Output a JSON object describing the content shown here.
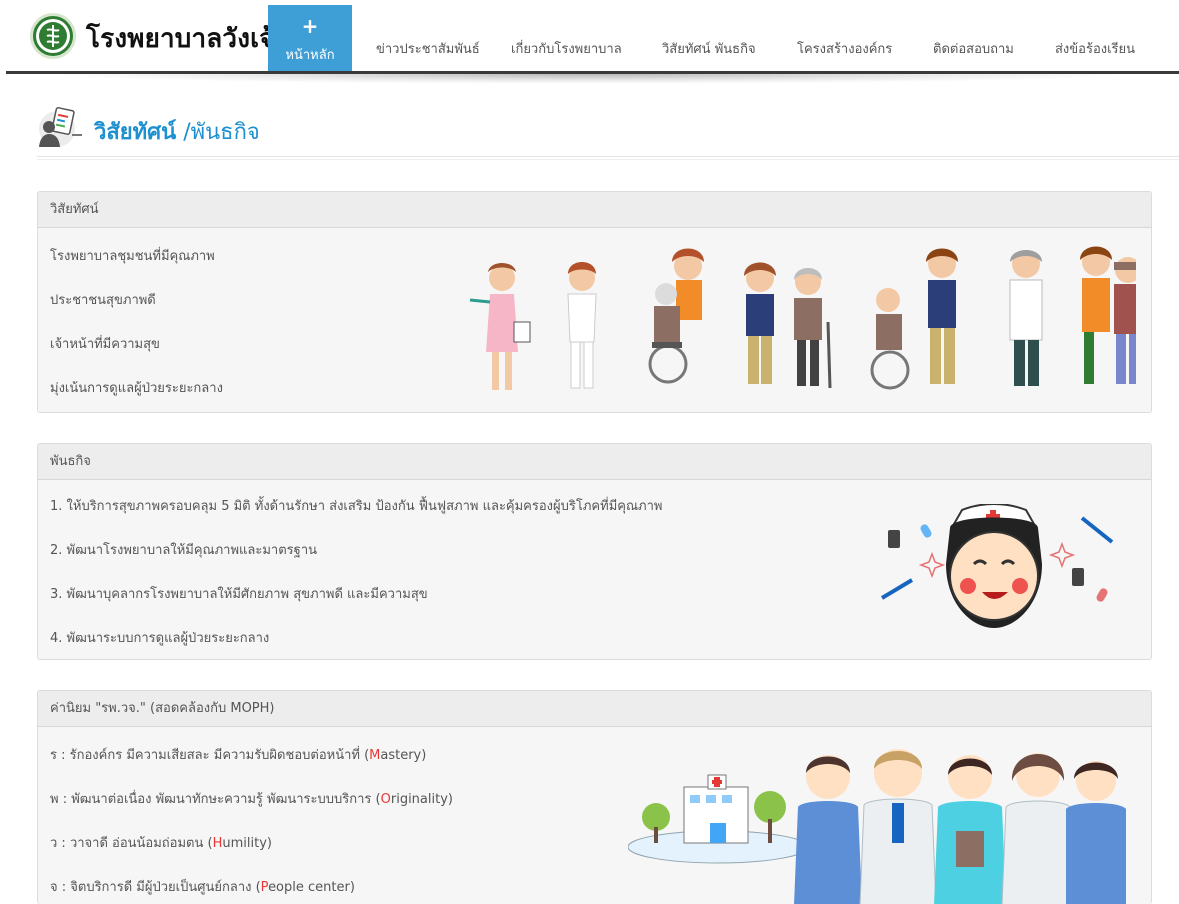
{
  "header": {
    "brand": "โรงพยาบาลวังเจ้า",
    "home": {
      "icon": "plus-icon",
      "label": "หน้าหลัก"
    },
    "nav": [
      "ข่าวประชาสัมพันธ์",
      "เกี่ยวกับโรงพยาบาล",
      "วิสัยทัศน์ พันธกิจ",
      "โครงสร้างองค์กร",
      "ติดต่อสอบถาม",
      "ส่งข้อร้องเรียน"
    ]
  },
  "page": {
    "title_main": "วิสัยทัศน์",
    "title_sep": "/",
    "title_sub": "พันธกิจ",
    "accent": "#1e90cf"
  },
  "vision": {
    "heading": "วิสัยทัศน์",
    "items": [
      "โรงพยาบาลชุมชนที่มีคุณภาพ",
      "ประชาชนสุขภาพดี",
      "เจ้าหน้าที่มีความสุข",
      "มุ่งเน้นการดูแลผู้ป่วยระยะกลาง"
    ]
  },
  "mission": {
    "heading": "พันธกิจ",
    "items": [
      "1. ให้บริการสุขภาพครอบคลุม 5 มิติ ทั้งด้านรักษา ส่งเสริม ป้องกัน ฟื้นฟูสภาพ และคุ้มครองผู้บริโภคที่มีคุณภาพ",
      "2. พัฒนาโรงพยาบาลให้มีคุณภาพและมาตรฐาน",
      "3. พัฒนาบุคลากรโรงพยาบาลให้มีศักยภาพ สุขภาพดี และมีความสุข",
      "4. พัฒนาระบบการดูแลผู้ป่วยระยะกลาง"
    ]
  },
  "values": {
    "heading": "ค่านิยม \"รพ.วจ.\" (สอดคล้องกับ MOPH)",
    "items": [
      {
        "pre": "ร : รักองค์กร มีความเสียสละ มีความรับผิดชอบต่อหน้าที่ (",
        "letter": "M",
        "rest": "astery)"
      },
      {
        "pre": "พ : พัฒนาต่อเนื่อง พัฒนาทักษะความรู้ พัฒนาระบบบริการ (",
        "letter": "O",
        "rest": "riginality)"
      },
      {
        "pre": "ว : วาจาดี อ่อนน้อมถ่อมตน (",
        "letter": "H",
        "rest": "umility)"
      },
      {
        "pre": "จ : จิตบริการดี มีผู้ป่วยเป็นศูนย์กลาง (",
        "letter": "P",
        "rest": "eople center)"
      }
    ],
    "highlight_color": "#e53935"
  }
}
